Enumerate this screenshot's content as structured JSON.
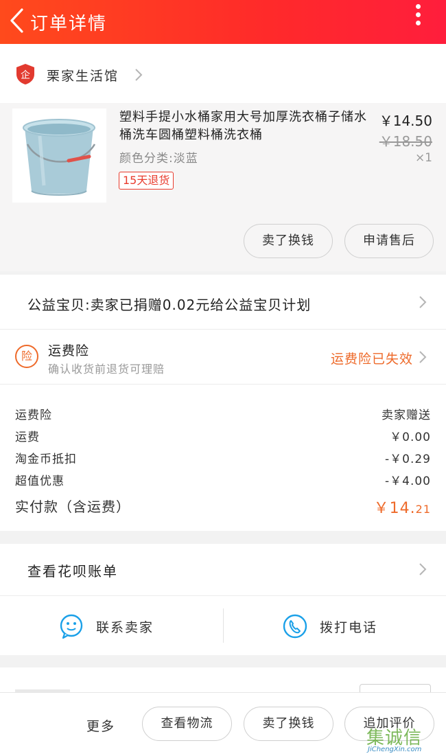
{
  "header": {
    "title": "订单详情",
    "back_icon": "chevron-left-icon",
    "more_icon": "more-vertical-icon",
    "colors": {
      "gradient_start": "#ff4a1c",
      "gradient_end": "#ff1e3c"
    }
  },
  "shop": {
    "name": "栗家生活馆",
    "logo_icon": "enterprise-badge-icon",
    "logo_text": "企"
  },
  "product": {
    "title": "塑料手提小水桶家用大号加厚洗衣桶子储水桶洗车圆桶塑料桶洗衣桶",
    "price": "￥14.50",
    "original_price": "￥18.50",
    "quantity": "×1",
    "variant": "颜色分类:淡蓝",
    "return_tag": "15天退货",
    "buttons": {
      "sell": "卖了换钱",
      "after_sale": "申请售后"
    }
  },
  "charity": {
    "text": "公益宝贝:卖家已捐赠0.02元给公益宝贝计划"
  },
  "shipping_insurance": {
    "icon_text": "险",
    "title": "运费险",
    "subtitle": "确认收货前退货可理赔",
    "status": "运费险已失效",
    "status_color": "#ee6a2a"
  },
  "costs": {
    "rows": [
      {
        "label": "运费险",
        "value": "卖家赠送"
      },
      {
        "label": "运费",
        "value": "￥0.00"
      },
      {
        "label": "淘金币抵扣",
        "value": "-￥0.29"
      },
      {
        "label": "超值优惠",
        "value": "-￥4.00"
      }
    ],
    "total_label": "实付款（含运费）",
    "total_value_main": "￥14.",
    "total_value_cents": "21",
    "accent_color": "#ee6a2a"
  },
  "huabei": {
    "text": "查看花呗账单"
  },
  "contact": {
    "seller": "联系卖家",
    "seller_icon": "chat-bubble-icon",
    "phone": "拨打电话",
    "phone_icon": "phone-icon",
    "icon_color": "#1aa0e8"
  },
  "bottom_bar": {
    "more": "更多",
    "logistics": "查看物流",
    "sell": "卖了换钱",
    "review": "追加评价"
  },
  "watermark": {
    "mark": "集诚信",
    "url": "JiChengXin.com"
  }
}
